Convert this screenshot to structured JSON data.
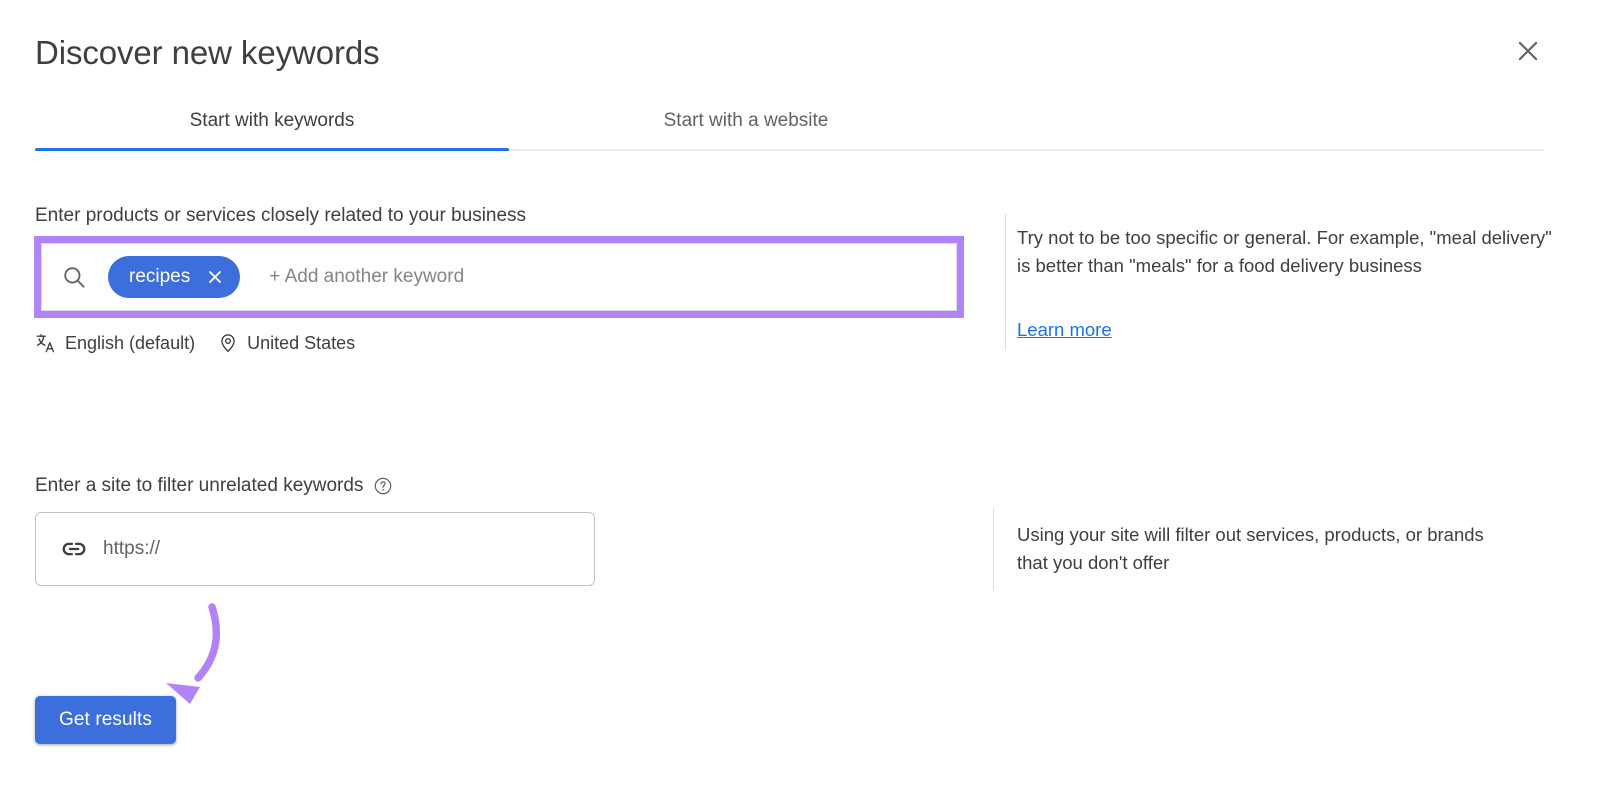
{
  "header": {
    "title": "Discover new keywords",
    "close_icon": "close-icon"
  },
  "tabs": [
    {
      "label": "Start with keywords",
      "active": true
    },
    {
      "label": "Start with a website",
      "active": false
    }
  ],
  "keywords_section": {
    "label": "Enter products or services closely related to your business",
    "search_icon": "search-icon",
    "chips": [
      {
        "text": "recipes",
        "remove_icon": "close-icon"
      }
    ],
    "placeholder": "+ Add another keyword",
    "meta": [
      {
        "icon": "translate-icon",
        "label": "English (default)"
      },
      {
        "icon": "location-pin-icon",
        "label": "United States"
      }
    ],
    "tip": "Try not to be too specific or general. For example, \"meal delivery\" is better than \"meals\" for a food delivery business",
    "learn_more": "Learn more"
  },
  "site_section": {
    "label": "Enter a site to filter unrelated keywords",
    "help_icon": "help-circle-icon",
    "link_icon": "link-icon",
    "placeholder": "https://",
    "value": "",
    "tip": "Using your site will filter out services, products, or brands that you don't offer"
  },
  "actions": {
    "get_results_label": "Get results"
  },
  "annotations": {
    "highlight_color": "#b084f7",
    "arrow_color": "#b084f7",
    "arrow_target": "get-results-button"
  },
  "colors": {
    "accent_blue": "#1a73e8",
    "button_blue": "#3c6fdb",
    "chip_blue": "#3c6fdb",
    "text_primary": "#3c4043",
    "text_secondary": "#5f6368",
    "placeholder": "#80868b",
    "border": "#dadce0"
  }
}
